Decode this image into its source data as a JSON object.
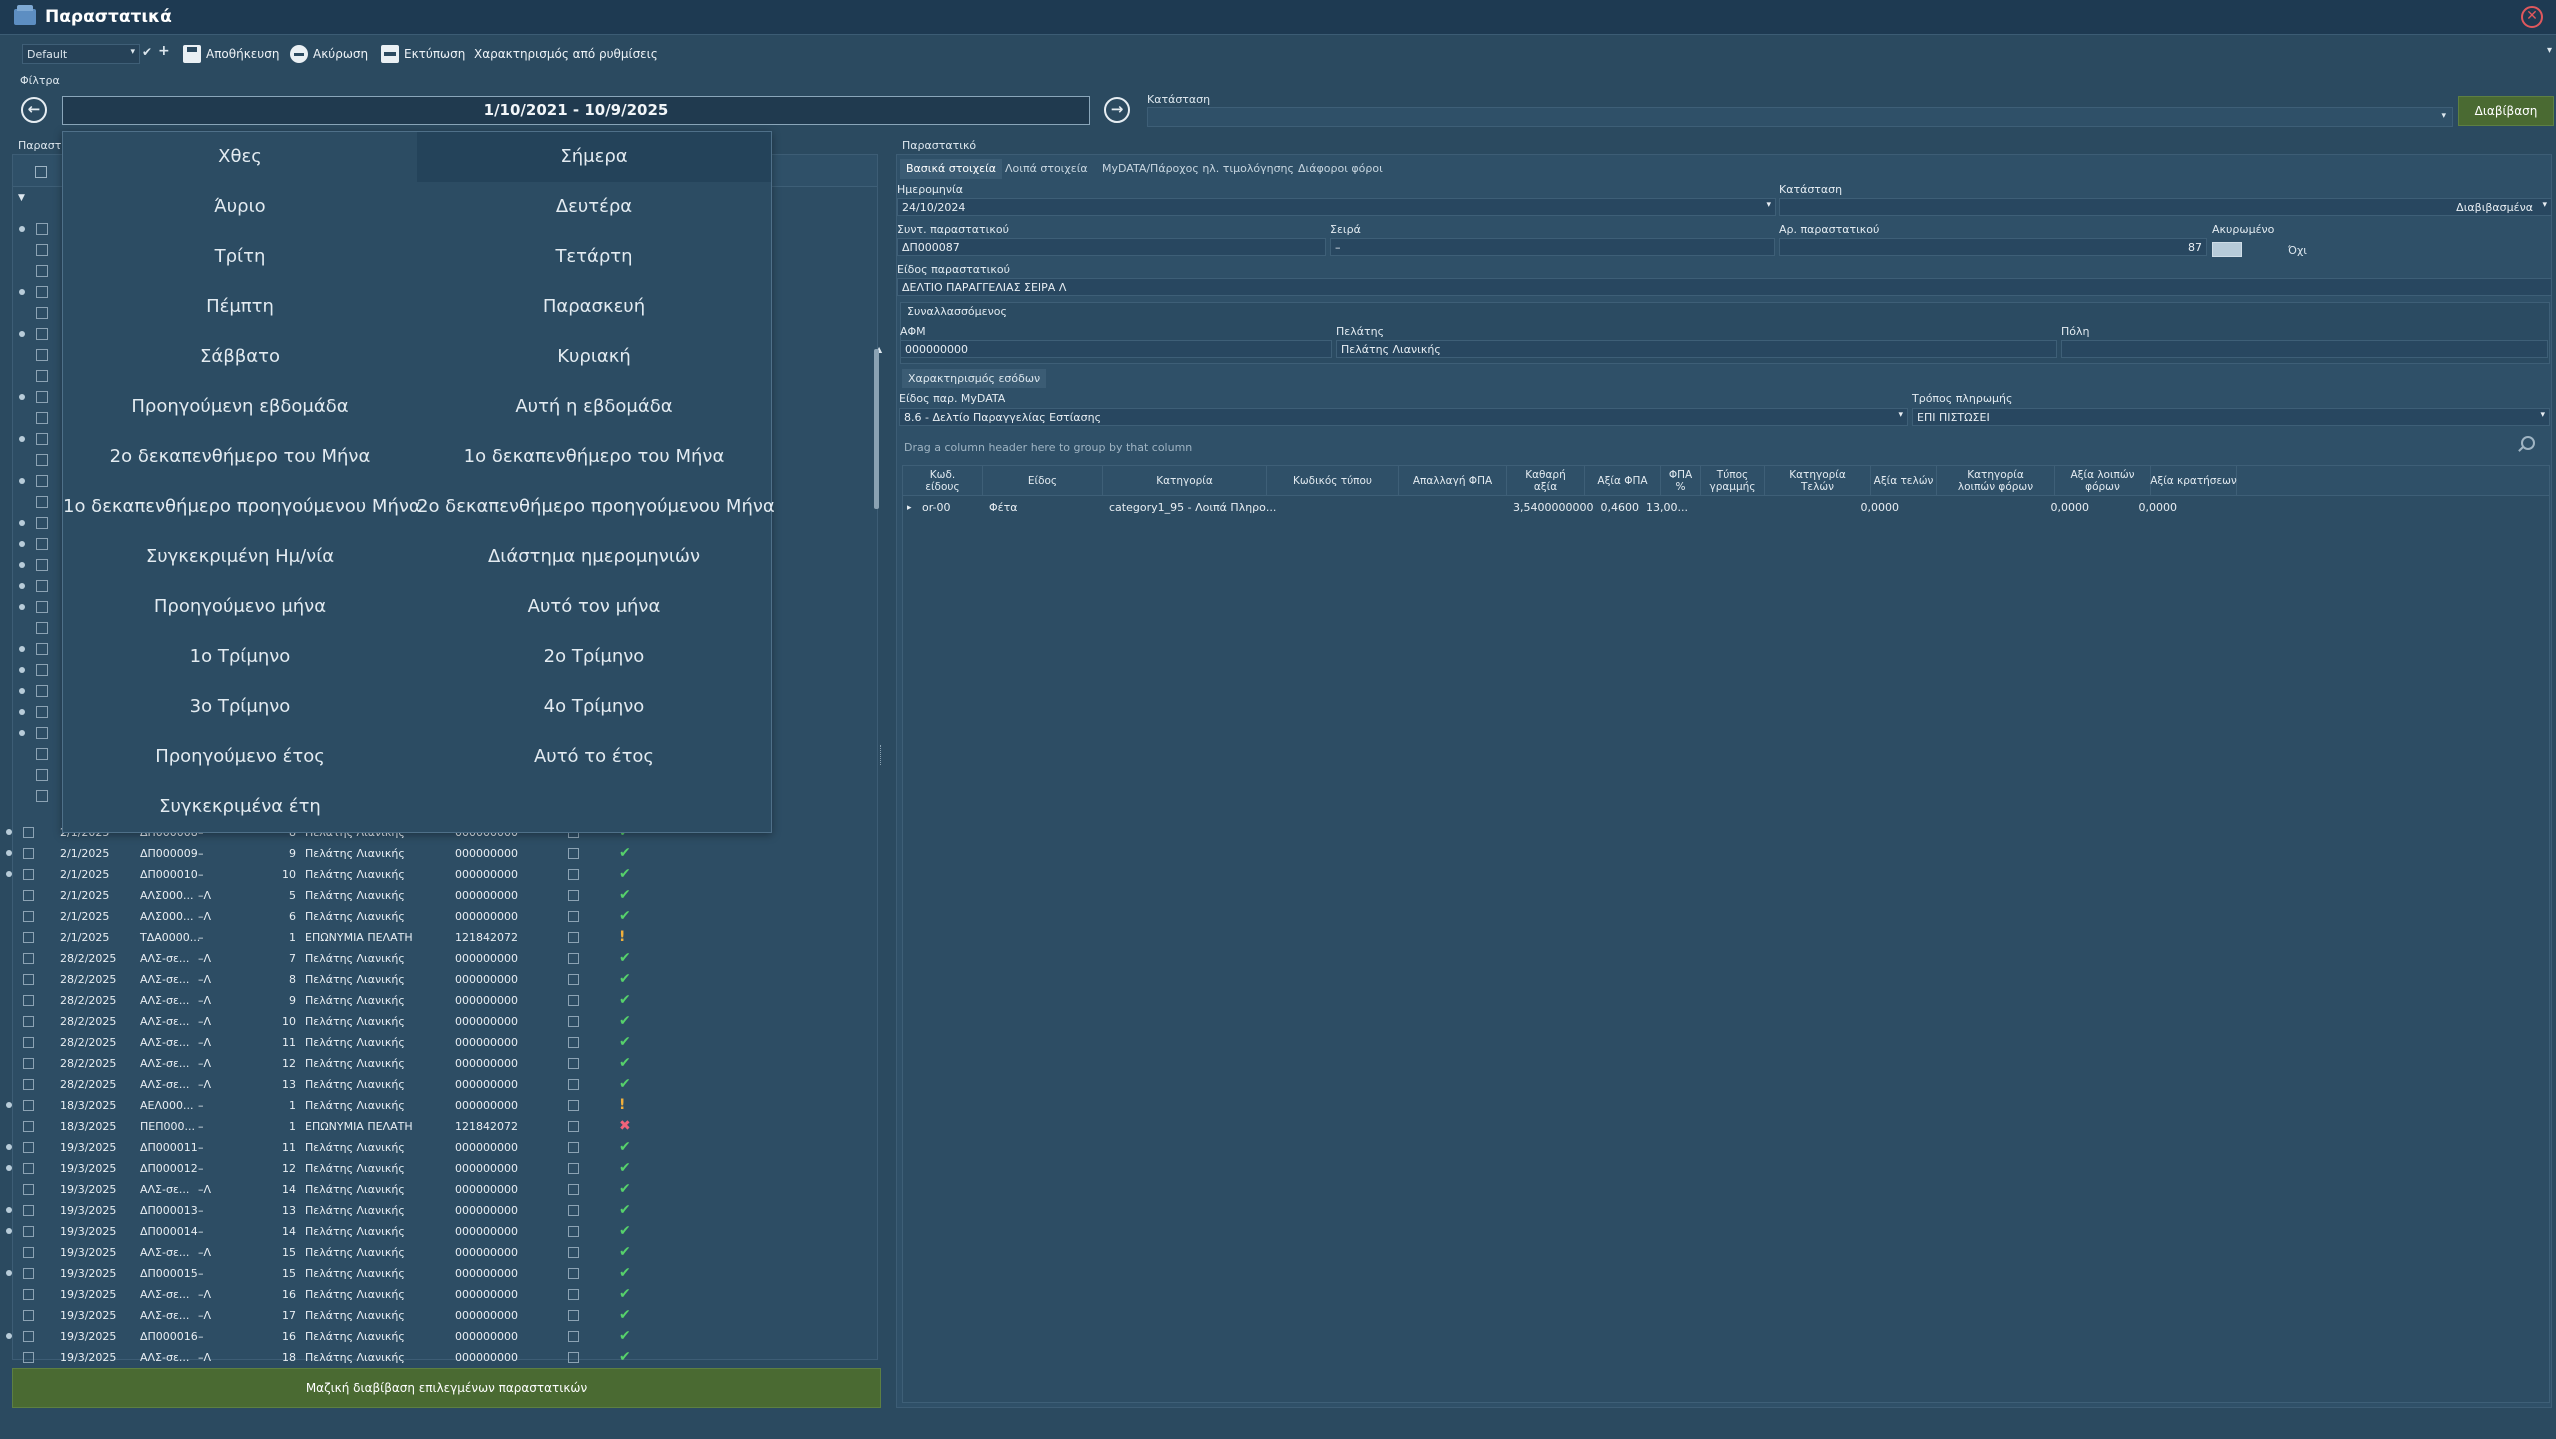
{
  "window": {
    "title": "Παραστατικά"
  },
  "toolbar": {
    "layout_value": "Default",
    "save_label": "Αποθήκευση",
    "cancel_label": "Ακύρωση",
    "print_label": "Εκτύπωση",
    "classify_label": "Χαρακτηρισμός από ρυθμίσεις"
  },
  "filters": {
    "label": "Φίλτρα",
    "date_range": "1/10/2021 - 10/9/2025",
    "status_label": "Κατάσταση",
    "read_button": "Διαβίβαση"
  },
  "left_panel": {
    "title": "Παραστ",
    "bulk_button": "Μαζική διαβίβαση επιλεγμένων παραστατικών",
    "rows": [
      {
        "date": "2/1/2025",
        "doc": "ΔΠ000008",
        "series": "–",
        "num": "8",
        "name": "Πελάτης Λιανικής",
        "afm": "000000000",
        "status": "ok",
        "mark": true
      },
      {
        "date": "2/1/2025",
        "doc": "ΔΠ000009",
        "series": "–",
        "num": "9",
        "name": "Πελάτης Λιανικής",
        "afm": "000000000",
        "status": "ok",
        "mark": true
      },
      {
        "date": "2/1/2025",
        "doc": "ΔΠ000010",
        "series": "–",
        "num": "10",
        "name": "Πελάτης Λιανικής",
        "afm": "000000000",
        "status": "ok",
        "mark": true
      },
      {
        "date": "2/1/2025",
        "doc": "ΑΛΣ000...",
        "series": "–Λ",
        "num": "5",
        "name": "Πελάτης Λιανικής",
        "afm": "000000000",
        "status": "ok",
        "mark": false
      },
      {
        "date": "2/1/2025",
        "doc": "ΑΛΣ000...",
        "series": "–Λ",
        "num": "6",
        "name": "Πελάτης Λιανικής",
        "afm": "000000000",
        "status": "ok",
        "mark": false
      },
      {
        "date": "2/1/2025",
        "doc": "ΤΔΑ0000...",
        "series": "–",
        "num": "1",
        "name": "ΕΠΩΝΥΜΙΑ ΠΕΛΑΤΗ",
        "afm": "121842072",
        "status": "warn",
        "mark": false
      },
      {
        "date": "28/2/2025",
        "doc": "ΑΛΣ-σε...",
        "series": "–Λ",
        "num": "7",
        "name": "Πελάτης Λιανικής",
        "afm": "000000000",
        "status": "ok",
        "mark": false
      },
      {
        "date": "28/2/2025",
        "doc": "ΑΛΣ-σε...",
        "series": "–Λ",
        "num": "8",
        "name": "Πελάτης Λιανικής",
        "afm": "000000000",
        "status": "ok",
        "mark": false
      },
      {
        "date": "28/2/2025",
        "doc": "ΑΛΣ-σε...",
        "series": "–Λ",
        "num": "9",
        "name": "Πελάτης Λιανικής",
        "afm": "000000000",
        "status": "ok",
        "mark": false
      },
      {
        "date": "28/2/2025",
        "doc": "ΑΛΣ-σε...",
        "series": "–Λ",
        "num": "10",
        "name": "Πελάτης Λιανικής",
        "afm": "000000000",
        "status": "ok",
        "mark": false
      },
      {
        "date": "28/2/2025",
        "doc": "ΑΛΣ-σε...",
        "series": "–Λ",
        "num": "11",
        "name": "Πελάτης Λιανικής",
        "afm": "000000000",
        "status": "ok",
        "mark": false
      },
      {
        "date": "28/2/2025",
        "doc": "ΑΛΣ-σε...",
        "series": "–Λ",
        "num": "12",
        "name": "Πελάτης Λιανικής",
        "afm": "000000000",
        "status": "ok",
        "mark": false
      },
      {
        "date": "28/2/2025",
        "doc": "ΑΛΣ-σε...",
        "series": "–Λ",
        "num": "13",
        "name": "Πελάτης Λιανικής",
        "afm": "000000000",
        "status": "ok",
        "mark": false
      },
      {
        "date": "18/3/2025",
        "doc": "ΑΕΛ000...",
        "series": "–",
        "num": "1",
        "name": "Πελάτης Λιανικής",
        "afm": "000000000",
        "status": "warn",
        "mark": true
      },
      {
        "date": "18/3/2025",
        "doc": "ΠΕΠ000...",
        "series": "–",
        "num": "1",
        "name": "ΕΠΩΝΥΜΙΑ ΠΕΛΑΤΗ",
        "afm": "121842072",
        "status": "err",
        "mark": false
      },
      {
        "date": "19/3/2025",
        "doc": "ΔΠ000011",
        "series": "–",
        "num": "11",
        "name": "Πελάτης Λιανικής",
        "afm": "000000000",
        "status": "ok",
        "mark": true
      },
      {
        "date": "19/3/2025",
        "doc": "ΔΠ000012",
        "series": "–",
        "num": "12",
        "name": "Πελάτης Λιανικής",
        "afm": "000000000",
        "status": "ok",
        "mark": true
      },
      {
        "date": "19/3/2025",
        "doc": "ΑΛΣ-σε...",
        "series": "–Λ",
        "num": "14",
        "name": "Πελάτης Λιανικής",
        "afm": "000000000",
        "status": "ok",
        "mark": false
      },
      {
        "date": "19/3/2025",
        "doc": "ΔΠ000013",
        "series": "–",
        "num": "13",
        "name": "Πελάτης Λιανικής",
        "afm": "000000000",
        "status": "ok",
        "mark": true
      },
      {
        "date": "19/3/2025",
        "doc": "ΔΠ000014",
        "series": "–",
        "num": "14",
        "name": "Πελάτης Λιανικής",
        "afm": "000000000",
        "status": "ok",
        "mark": true
      },
      {
        "date": "19/3/2025",
        "doc": "ΑΛΣ-σε...",
        "series": "–Λ",
        "num": "15",
        "name": "Πελάτης Λιανικής",
        "afm": "000000000",
        "status": "ok",
        "mark": false
      },
      {
        "date": "19/3/2025",
        "doc": "ΔΠ000015",
        "series": "–",
        "num": "15",
        "name": "Πελάτης Λιανικής",
        "afm": "000000000",
        "status": "ok",
        "mark": true
      },
      {
        "date": "19/3/2025",
        "doc": "ΑΛΣ-σε...",
        "series": "–Λ",
        "num": "16",
        "name": "Πελάτης Λιανικής",
        "afm": "000000000",
        "status": "ok",
        "mark": false
      },
      {
        "date": "19/3/2025",
        "doc": "ΑΛΣ-σε...",
        "series": "–Λ",
        "num": "17",
        "name": "Πελάτης Λιανικής",
        "afm": "000000000",
        "status": "ok",
        "mark": false
      },
      {
        "date": "19/3/2025",
        "doc": "ΔΠ000016",
        "series": "–",
        "num": "16",
        "name": "Πελάτης Λιανικής",
        "afm": "000000000",
        "status": "ok",
        "mark": true
      },
      {
        "date": "19/3/2025",
        "doc": "ΑΛΣ-σε...",
        "series": "–Λ",
        "num": "18",
        "name": "Πελάτης Λιανικής",
        "afm": "000000000",
        "status": "ok",
        "mark": false
      }
    ]
  },
  "date_dropdown": {
    "items_left": [
      "Χθες",
      "Άυριο",
      "Τρίτη",
      "Πέμπτη",
      "Σάββατο",
      "Προηγούμενη εβδομάδα",
      "2ο δεκαπενθήμερο του Μήνα",
      "1ο δεκαπενθήμερο προηγούμενου Μήνα",
      "Συγκεκριμένη Ημ/νία",
      "Προηγούμενο μήνα",
      "1ο Τρίμηνο",
      "3ο Τρίμηνο",
      "Προηγούμενο έτος",
      "Συγκεκριμένα έτη"
    ],
    "items_right": [
      "Σήμερα",
      "Δευτέρα",
      "Τετάρτη",
      "Παρασκευή",
      "Κυριακή",
      "Αυτή η εβδομάδα",
      "1ο δεκαπενθήμερο του Μήνα",
      "2ο δεκαπενθήμερο προηγούμενου Μήνα",
      "Διάστημα ημερομηνιών",
      "Αυτό τον μήνα",
      "2ο Τρίμηνο",
      "4ο Τρίμηνο",
      "Αυτό το έτος"
    ],
    "selected": "Σήμερα"
  },
  "document": {
    "title": "Παραστατικό",
    "tabs": [
      "Βασικά στοιχεία",
      "Λοιπά στοιχεία",
      "MyDATA/Πάροχος ηλ. τιμολόγησης",
      "Διάφοροι φόροι"
    ],
    "date_label": "Ημερομηνία",
    "date_value": "24/10/2024",
    "state_label": "Κατάσταση",
    "state_value": "Διαβιβασμένα",
    "abbrev_label": "Συντ. παραστατικού",
    "abbrev_value": "ΔΠ000087",
    "series_label": "Σειρά",
    "series_value": "–",
    "number_label": "Αρ. παραστατικού",
    "number_value": "87",
    "cancelled_label": "Ακυρωμένο",
    "cancelled_value": "Όχι",
    "type_label": "Είδος παραστατικού",
    "type_value": "ΔΕΛΤΙΟ ΠΑΡΑΓΓΕΛΙΑΣ ΣΕΙΡΑ Λ",
    "counterparty_title": "Συναλλασσόμενος",
    "afm_label": "ΑΦΜ",
    "afm_value": "000000000",
    "customer_label": "Πελάτης",
    "customer_value": "Πελάτης Λιανικής",
    "city_label": "Πόλη",
    "income_tab": "Χαρακτηρισμός εσόδων",
    "mydata_type_label": "Είδος παρ. MyDATA",
    "mydata_type_value": "8.6 - Δελτίο Παραγγελίας Εστίασης",
    "payment_label": "Τρόπος πληρωμής",
    "payment_value": "ΕΠΙ ΠΙΣΤΩΣΕΙ",
    "group_hint": "Drag a column header here to group by that column",
    "lines_headers": [
      "Κωδ.\nείδους",
      "Είδος",
      "Κατηγορία",
      "Κωδικός τύπου",
      "Απαλλαγή ΦΠΑ",
      "Καθαρή\nαξία",
      "Αξία ΦΠΑ",
      "ΦΠΑ\n%",
      "Τύπος\nγραμμής",
      "Κατηγορία\nΤελών",
      "Αξία τελών",
      "Κατηγορία\nλοιπών φόρων",
      "Αξία λοιπών\nφόρων",
      "Αξία κρατήσεων"
    ],
    "line": {
      "code": "or-00",
      "item": "Φέτα",
      "category": "category1_95 - Λοιπά Πληρο...",
      "net": "3,5400000000",
      "vat": "0,4600",
      "vat_pct": "13,00...",
      "fees": "0,0000",
      "other_taxes": "0,0000",
      "withholdings": "0,0000"
    }
  },
  "colors": {
    "ok": "#56d16b",
    "warn": "#f1b03b",
    "err": "#f0637a",
    "accent_button": "#4a6a32"
  }
}
